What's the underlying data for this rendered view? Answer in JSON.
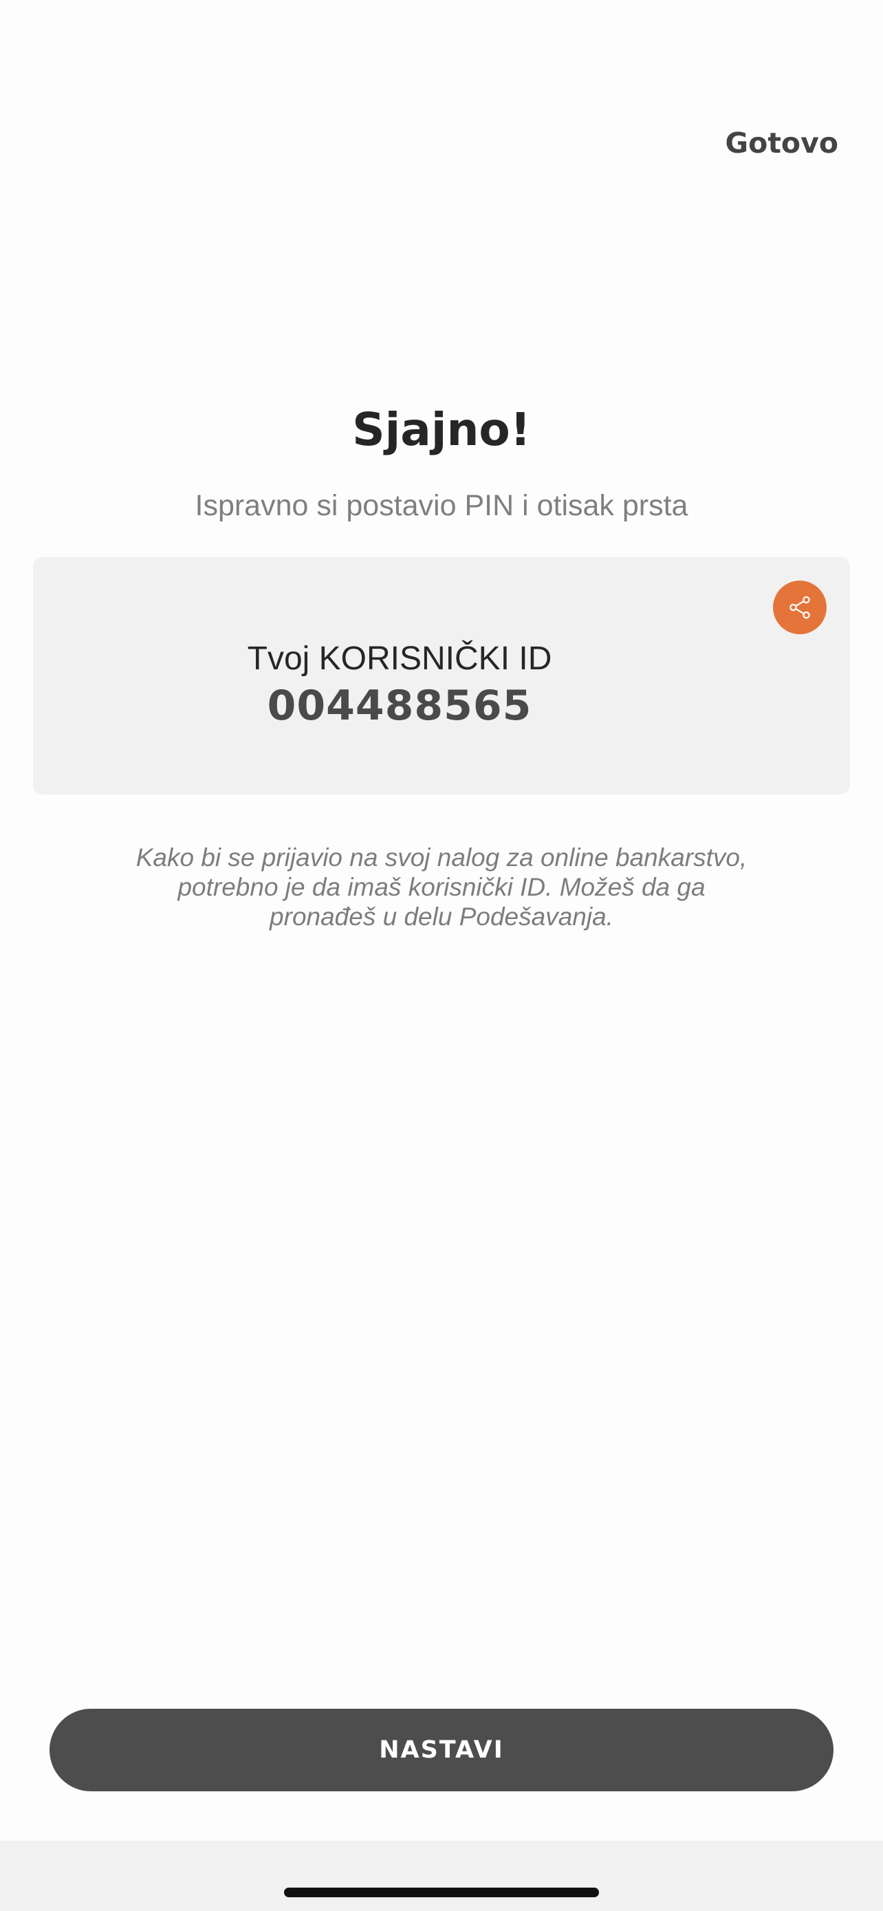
{
  "header": {
    "done_label": "Gotovo"
  },
  "main": {
    "title": "Sjajno!",
    "subtitle": "Ispravno si postavio PIN i otisak prsta",
    "id_card": {
      "label": "Tvoj KORISNIČKI ID",
      "value": "004488565",
      "share_icon": "share-icon"
    },
    "info_text": "Kako bi se prijavio na svoj nalog za online bankarstvo, potrebno je da imaš korisnički ID. Možeš da ga pronađeš u delu Podešavanja."
  },
  "footer": {
    "continue_label": "NASTAVI"
  },
  "colors": {
    "accent": "#e5743a",
    "button": "#4d4d4d",
    "card": "#f1f1f1"
  }
}
